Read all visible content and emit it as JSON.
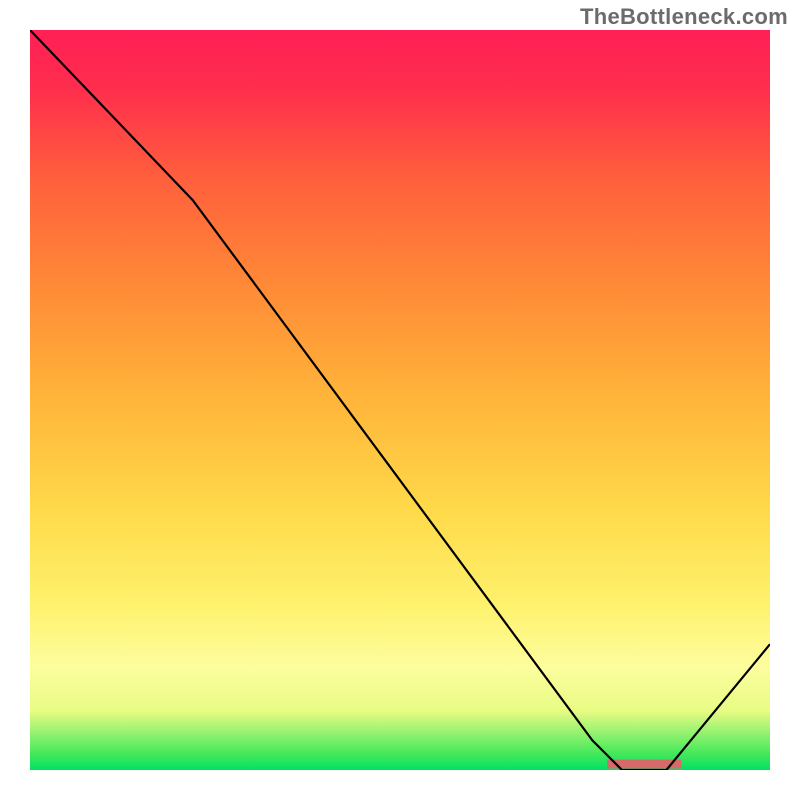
{
  "attribution": "TheBottleneck.com",
  "chart_data": {
    "type": "line",
    "title": "",
    "xlabel": "",
    "ylabel": "",
    "xlim": [
      0,
      100
    ],
    "ylim": [
      0,
      100
    ],
    "grid": false,
    "legend": false,
    "series": [
      {
        "name": "curve",
        "x": [
          0,
          22,
          76,
          80,
          86,
          100
        ],
        "y": [
          100,
          77,
          4,
          0,
          0,
          17
        ],
        "color": "#000000"
      }
    ],
    "markers": [
      {
        "name": "target-bar",
        "shape": "rect",
        "x0": 78,
        "x1": 88,
        "y0": 0.2,
        "y1": 1.4,
        "fill": "#d66a68"
      }
    ],
    "gradient_stops": [
      {
        "pos": 0,
        "color": "#00e162"
      },
      {
        "pos": 2,
        "color": "#3fe85a"
      },
      {
        "pos": 8,
        "color": "#e8fc84"
      },
      {
        "pos": 14,
        "color": "#fdfd9e"
      },
      {
        "pos": 22,
        "color": "#fef26e"
      },
      {
        "pos": 35,
        "color": "#ffda4a"
      },
      {
        "pos": 50,
        "color": "#ffb53a"
      },
      {
        "pos": 65,
        "color": "#ff8b37"
      },
      {
        "pos": 80,
        "color": "#ff5f3c"
      },
      {
        "pos": 92,
        "color": "#ff2e4d"
      },
      {
        "pos": 100,
        "color": "#ff1f55"
      }
    ]
  }
}
